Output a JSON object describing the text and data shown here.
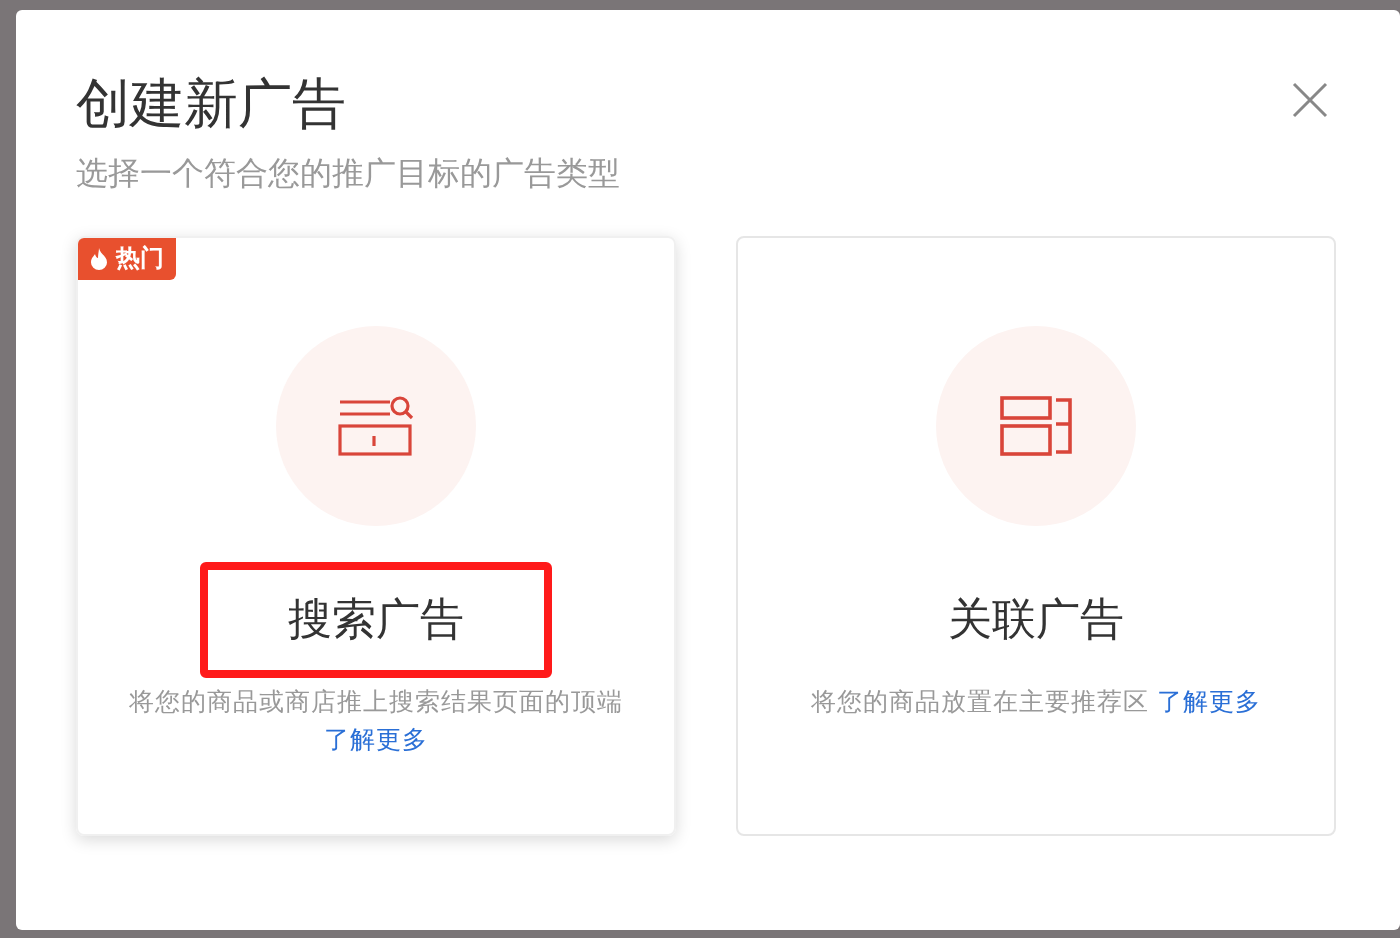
{
  "dialog": {
    "title": "创建新广告",
    "subtitle": "选择一个符合您的推广目标的广告类型"
  },
  "cards": [
    {
      "kind": "search",
      "badge": "热门",
      "title": "搜索广告",
      "description": "将您的商品或商店推上搜索结果页面的顶端",
      "link": "了解更多",
      "selected": true,
      "highlighted": true
    },
    {
      "kind": "related",
      "title": "关联广告",
      "description": "将您的商品放置在主要推荐区",
      "link": "了解更多",
      "selected": false,
      "highlighted": false
    }
  ]
}
